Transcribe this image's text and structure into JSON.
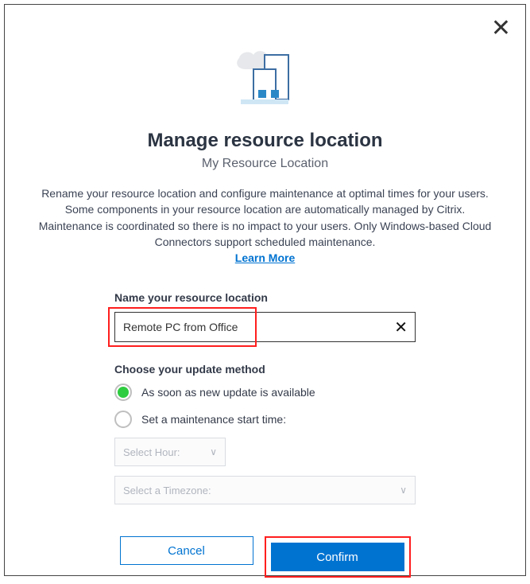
{
  "dialog": {
    "title": "Manage resource location",
    "subtitle": "My Resource Location",
    "description": "Rename your resource location and configure maintenance at optimal times for your users. Some components in your resource location are automatically managed by Citrix. Maintenance is coordinated so there is no impact to your users. Only Windows-based Cloud Connectors support scheduled maintenance.",
    "learn_more": "Learn More"
  },
  "form": {
    "name_label": "Name your resource location",
    "name_value": "Remote PC from Office",
    "update_label": "Choose your update method",
    "option_asap": "As soon as new update is available",
    "option_scheduled": "Set a maintenance start time:",
    "select_hour_placeholder": "Select Hour:",
    "select_tz_placeholder": "Select a Timezone:"
  },
  "buttons": {
    "cancel": "Cancel",
    "confirm": "Confirm"
  }
}
